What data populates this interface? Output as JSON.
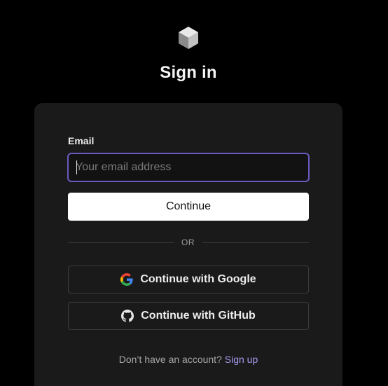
{
  "header": {
    "logo_icon": "cube-logo-icon",
    "title": "Sign in"
  },
  "form": {
    "email_label": "Email",
    "email_value": "",
    "email_placeholder": "Your email address",
    "continue_label": "Continue",
    "divider_text": "OR"
  },
  "oauth": {
    "google_label": "Continue with Google",
    "google_icon": "google-icon",
    "github_label": "Continue with GitHub",
    "github_icon": "github-icon"
  },
  "footer": {
    "prompt": "Don’t have an account?",
    "signup_label": "Sign up"
  },
  "colors": {
    "background": "#000000",
    "card": "#1a1a1a",
    "focus_border": "#6a5bc0",
    "link": "#a59cf0"
  }
}
